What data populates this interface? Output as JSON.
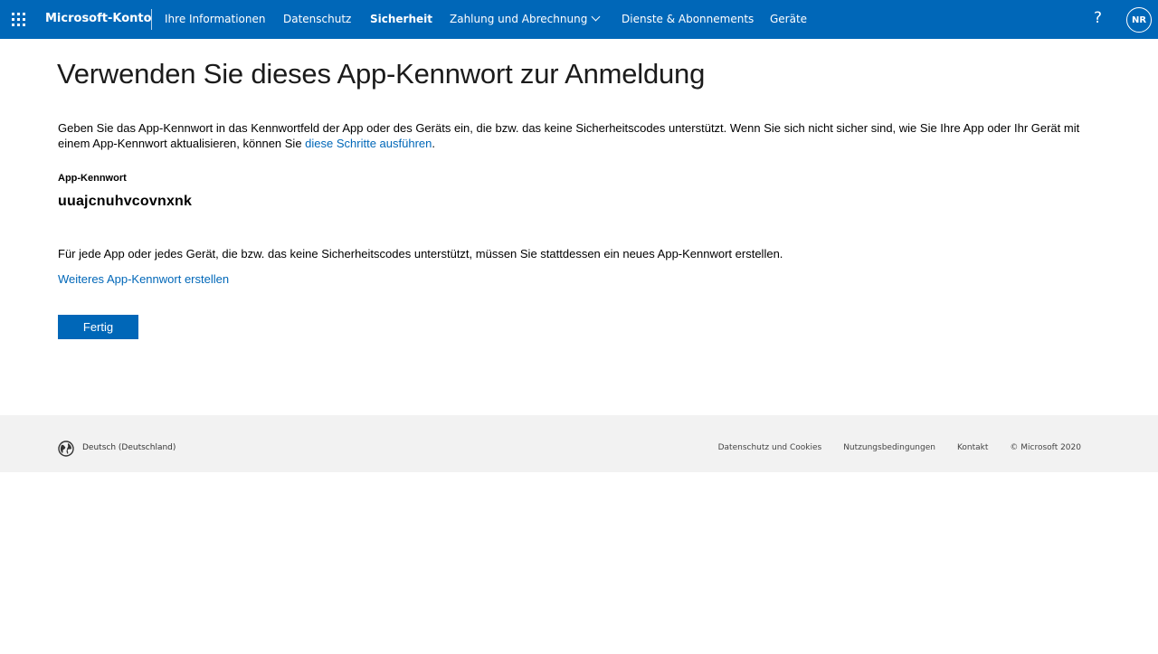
{
  "header": {
    "brand": "Microsoft-Konto",
    "nav": [
      "Ihre Informationen",
      "Datenschutz",
      "Sicherheit",
      "Zahlung und Abrechnung",
      "Dienste & Abonnements",
      "Geräte"
    ],
    "active_nav": "Sicherheit",
    "help_label": "?",
    "avatar_initials": "NR",
    "accent_color": "#0067b8"
  },
  "main": {
    "title": "Verwenden Sie dieses App-Kennwort zur Anmeldung",
    "intro_text": "Geben Sie das App-Kennwort in das Kennwortfeld der App oder des Geräts ein, die bzw. das keine Sicherheitscodes unterstützt. Wenn Sie sich nicht sicher sind, wie Sie Ihre App oder Ihr Gerät mit einem App-Kennwort aktualisieren, können Sie ",
    "intro_link": "diese Schritte ausführen",
    "intro_end": ".",
    "password_label": "App-Kennwort",
    "password_value": "uuajcnuhvcovnxnk",
    "note": "Für jede App oder jedes Gerät, die bzw. das keine Sicherheitscodes unterstützt, müssen Sie stattdessen ein neues App-Kennwort erstellen.",
    "another_link": "Weiteres App-Kennwort erstellen",
    "done_button": "Fertig"
  },
  "footer": {
    "locale": "Deutsch (Deutschland)",
    "links": [
      "Datenschutz und Cookies",
      "Nutzungsbedingungen",
      "Kontakt"
    ],
    "copyright": "© Microsoft 2020",
    "icon": "globe-icon"
  }
}
